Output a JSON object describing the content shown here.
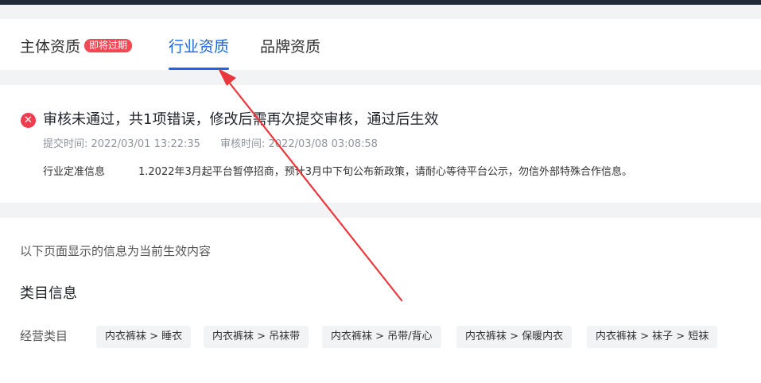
{
  "tabs": {
    "items": [
      {
        "label": "主体资质",
        "active": false
      },
      {
        "label": "行业资质",
        "active": true
      },
      {
        "label": "品牌资质",
        "active": false
      }
    ],
    "badge": "即将过期"
  },
  "audit": {
    "status_icon": "error-circle-icon",
    "title": "审核未通过，共1项错误，修改后需再次提交审核，通过后生效",
    "submit_time": "提交时间: 2022/03/01 13:22:35",
    "review_time": "审核时间: 2022/03/08 03:08:58",
    "notice_label": "行业定准信息",
    "notice_text": "1.2022年3月起平台暂停招商，预计3月中下旬公布新政策，请耐心等待平台公示，勿信外部特殊合作信息。"
  },
  "content": {
    "effective_tip": "以下页面显示的信息为当前生效内容",
    "section_title": "类目信息",
    "category_label": "经营类目",
    "categories": [
      "内衣裤袜 > 睡衣",
      "内衣裤袜 > 吊袜带",
      "内衣裤袜 > 吊带/背心",
      "内衣裤袜 > 保暖内衣",
      "内衣裤袜 > 袜子 > 短袜"
    ]
  },
  "colors": {
    "accent": "#1966e0",
    "error": "#f03c4e",
    "annotation_arrow": "#e8383d"
  }
}
